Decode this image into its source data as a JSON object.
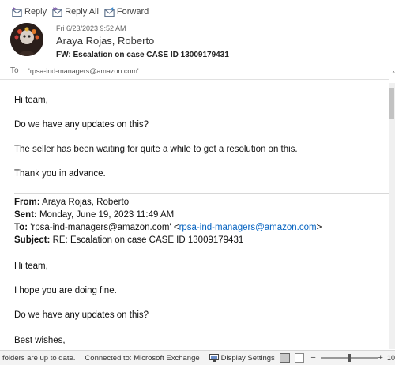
{
  "actions": {
    "reply_label": "Reply",
    "reply_all_label": "Reply All",
    "forward_label": "Forward"
  },
  "header": {
    "date": "Fri 6/23/2023 9:52 AM",
    "sender": "Araya Rojas, Roberto",
    "subject": "FW: Escalation on case CASE ID 13009179431",
    "to_label": "To",
    "to_value": "'rpsa-ind-managers@amazon.com'",
    "more_glyph": "^"
  },
  "body": {
    "p1": "Hi team,",
    "p2": "Do we have any updates on this?",
    "p3": "The seller has been waiting for quite a while to get a resolution on this.",
    "p4": "Thank you in advance."
  },
  "forwarded": {
    "from_label": "From:",
    "from_value": "Araya Rojas, Roberto",
    "sent_label": "Sent:",
    "sent_value": "Monday, June 19, 2023 11:49 AM",
    "to_label": "To:",
    "to_value": "'rpsa-ind-managers@amazon.com' <",
    "to_link": "rpsa-ind-managers@amazon.com",
    "to_close": ">",
    "subject_label": "Subject:",
    "subject_value": "RE: Escalation on case CASE ID 13009179431",
    "p1": "Hi team,",
    "p2": "I hope you are doing fine.",
    "p3": "Do we have any updates on this?",
    "p4": "Best wishes,"
  },
  "status": {
    "folders": "folders are up to date.",
    "connection": "Connected to: Microsoft Exchange",
    "display_settings": "Display Settings",
    "minus": "−",
    "plus": "+",
    "zoom": "10"
  },
  "colors": {
    "link": "#0563c1",
    "statusbar": "#f3f3f3",
    "accent": "#2b579a"
  },
  "icons": [
    "reply-icon",
    "reply-all-icon",
    "forward-icon",
    "display-settings-icon"
  ]
}
